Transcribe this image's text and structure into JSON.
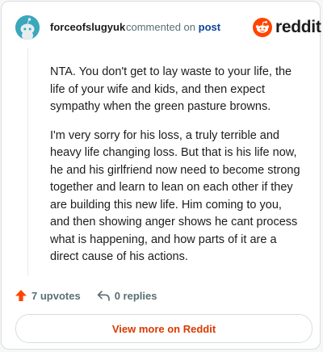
{
  "comment": {
    "author": "forceofslugyuk",
    "meta_text": "commented on",
    "meta_link": "post",
    "paragraphs": [
      "NTA. You don't get to lay waste to your life, the life of your wife and kids, and then expect sympathy when the green pasture browns.",
      "I'm very sorry for his loss, a truly terrible and heavy life changing loss. But that is his life now, he and his girlfriend now need to become strong together and learn to lean on each other if they are building this new life. Him coming to you, and then showing anger shows he cant process what is happening, and how parts of it are a direct cause of his actions."
    ]
  },
  "brand": {
    "logo_text": "reddit",
    "accent": "#ff4500"
  },
  "actions": {
    "upvotes": "7 upvotes",
    "replies": "0 replies"
  },
  "cta": {
    "label": "View more on Reddit"
  },
  "icons": {
    "avatar": "snoo-avatar-icon",
    "logo": "reddit-logo-icon",
    "upvote": "upvote-arrow-icon",
    "reply": "reply-arrow-icon"
  }
}
